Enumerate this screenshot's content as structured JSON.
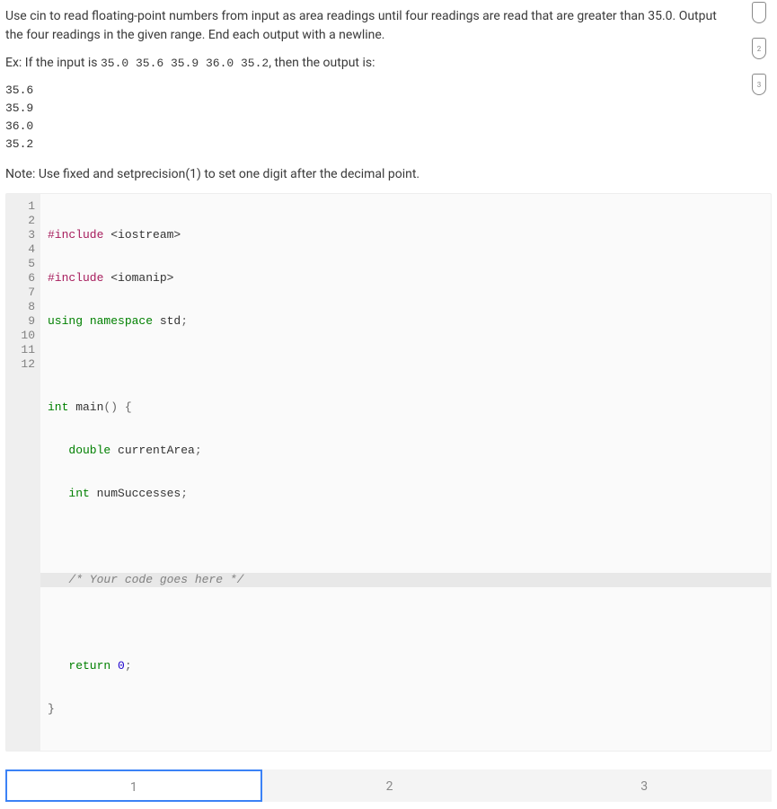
{
  "instructions": {
    "para1": "Use cin to read floating-point numbers from input as area readings until four readings are read that are greater than 35.0. Output the four readings in the given range. End each output with a newline.",
    "ex_label": "Ex: If the input is ",
    "ex_input": "35.0 35.6 35.9 36.0 35.2",
    "ex_suffix": ", then the output is:",
    "output_lines": [
      "35.6",
      "35.9",
      "36.0",
      "35.2"
    ],
    "note": "Note: Use fixed and setprecision(1) to set one digit after the decimal point."
  },
  "badges": [
    {
      "num": ""
    },
    {
      "num": "2"
    },
    {
      "num": "3"
    }
  ],
  "code": {
    "lines": [
      {
        "n": "1"
      },
      {
        "n": "2"
      },
      {
        "n": "3"
      },
      {
        "n": "4"
      },
      {
        "n": "5"
      },
      {
        "n": "6"
      },
      {
        "n": "7"
      },
      {
        "n": "8"
      },
      {
        "n": "9"
      },
      {
        "n": "10"
      },
      {
        "n": "11"
      },
      {
        "n": "12"
      }
    ],
    "t": {
      "include": "#include",
      "iostream": " <iostream>",
      "iomanip": " <iomanip>",
      "using": "using",
      "namespace": " namespace",
      "std": " std",
      "semi": ";",
      "int": "int",
      "main": " main",
      "parens": "()",
      "obrace": " {",
      "cbrace": "}",
      "indent1": "   ",
      "double": "double",
      "currentArea": " currentArea",
      "numSuccesses": " numSuccesses",
      "comment": "/* Your code goes here */",
      "return": "return",
      "zero": " 0"
    }
  },
  "tabs": {
    "items": [
      "1",
      "2",
      "3"
    ],
    "active": 0
  }
}
